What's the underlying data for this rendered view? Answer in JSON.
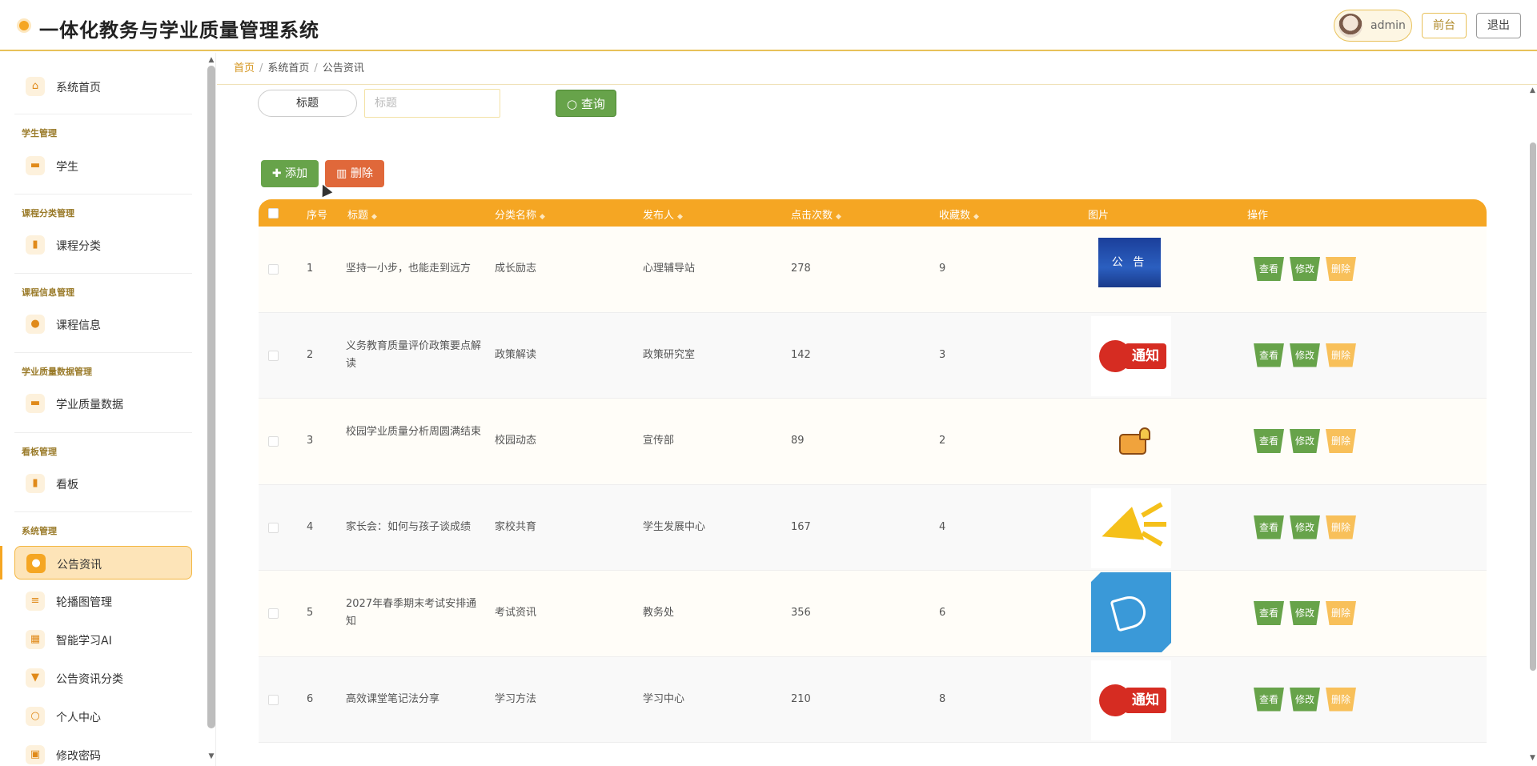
{
  "header": {
    "title": "一体化教务与学业质量管理系统",
    "user": "admin",
    "front_label": "前台",
    "logout_label": "退出"
  },
  "sidebar": {
    "home": "系统首页",
    "groups": [
      {
        "title": "学生管理",
        "item": "学生"
      },
      {
        "title": "课程分类管理",
        "item": "课程分类"
      },
      {
        "title": "课程信息管理",
        "item": "课程信息"
      },
      {
        "title": "学业质量数据管理",
        "item": "学业质量数据"
      },
      {
        "title": "看板管理",
        "item": "看板"
      }
    ],
    "system_group": "系统管理",
    "system_items": [
      "公告资讯",
      "轮播图管理",
      "智能学习AI",
      "公告资讯分类",
      "个人中心",
      "修改密码"
    ],
    "active_item": "公告资讯"
  },
  "breadcrumb": [
    "首页",
    "系统首页",
    "公告资讯"
  ],
  "search": {
    "label": "标题",
    "placeholder": "标题",
    "query_label": "查询"
  },
  "actions": {
    "add_label": "添加",
    "delete_label": "删除"
  },
  "table": {
    "columns": [
      "序号",
      "标题",
      "分类名称",
      "发布人",
      "点击次数",
      "收藏数",
      "图片",
      "操作"
    ],
    "rows": [
      {
        "no": "1",
        "title": "坚持一小步，也能走到远方",
        "category": "成长励志",
        "publisher": "心理辅导站",
        "clicks": "278",
        "favorites": "9",
        "image": "公 告"
      },
      {
        "no": "2",
        "title": "义务教育质量评价政策要点解读",
        "category": "政策解读",
        "publisher": "政策研究室",
        "clicks": "142",
        "favorites": "3",
        "image": "通知"
      },
      {
        "no": "3",
        "title": "校园学业质量分析周圆满结束",
        "category": "校园动态",
        "publisher": "宣传部",
        "clicks": "89",
        "favorites": "2",
        "image": ""
      },
      {
        "no": "4",
        "title": "家长会：如何与孩子谈成绩",
        "category": "家校共育",
        "publisher": "学生发展中心",
        "clicks": "167",
        "favorites": "4",
        "image": ""
      },
      {
        "no": "5",
        "title": "2027年春季期末考试安排通知",
        "category": "考试资讯",
        "publisher": "教务处",
        "clicks": "356",
        "favorites": "6",
        "image": ""
      },
      {
        "no": "6",
        "title": "高效课堂笔记法分享",
        "category": "学习方法",
        "publisher": "学习中心",
        "clicks": "210",
        "favorites": "8",
        "image": "通知"
      }
    ],
    "op_view": "查看",
    "op_edit": "修改",
    "op_delete": "删除"
  },
  "icons": {
    "home": "home-icon",
    "briefcase": "briefcase-icon",
    "bar_chart": "bar-chart-icon",
    "pin": "pin-icon",
    "sliders": "sliders-icon",
    "grid": "grid-icon",
    "user": "user-icon",
    "lock": "lock-icon",
    "search": "search-icon",
    "plus": "plus-icon",
    "trash": "trash-icon"
  },
  "colors": {
    "accent": "#f5a623",
    "green": "#67a34a",
    "danger": "#e0683a"
  }
}
